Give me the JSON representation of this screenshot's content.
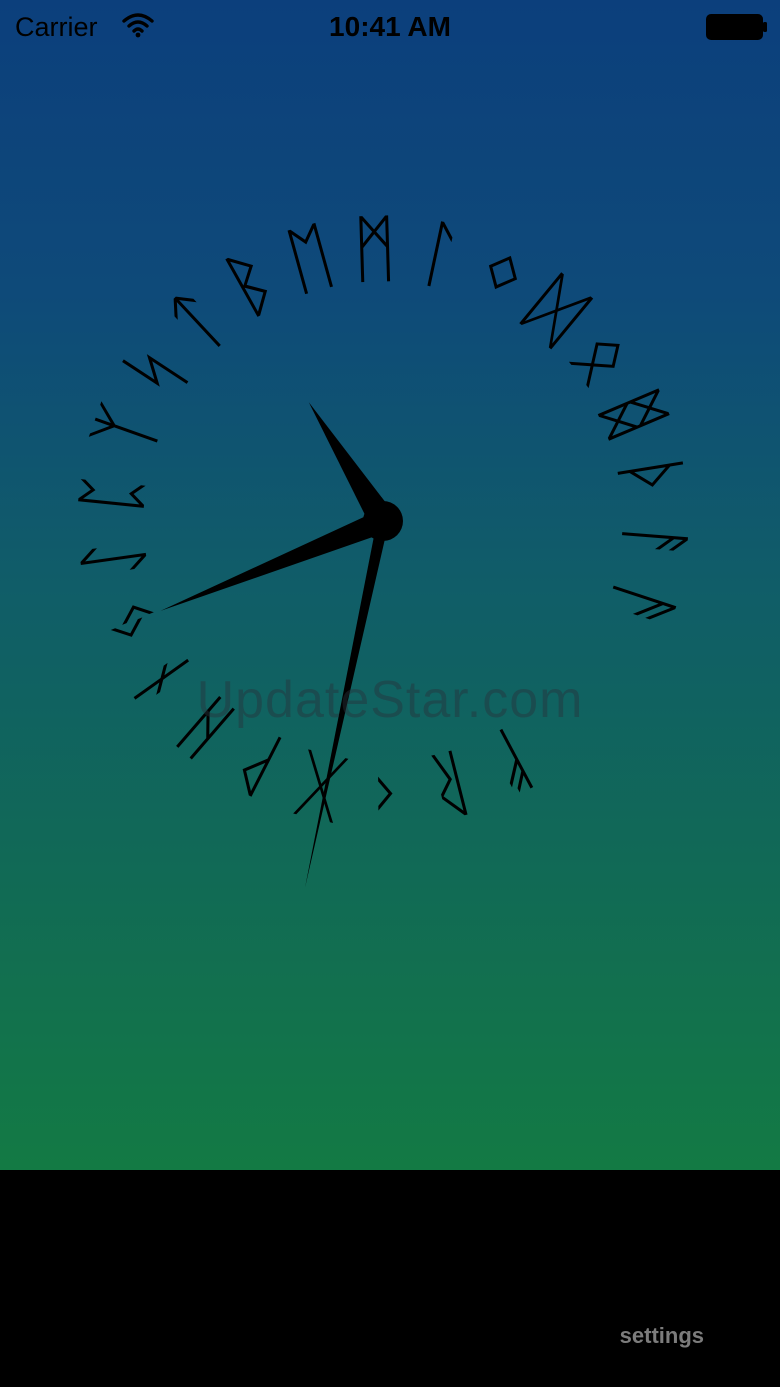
{
  "status_bar": {
    "carrier": "Carrier",
    "time": "10:41 AM",
    "wifi_icon": "wifi-icon",
    "battery_icon": "battery-full-icon"
  },
  "clock": {
    "face_style": "rune-ring",
    "runes": [
      "ᚠ",
      "ᚱ",
      "ᚲ",
      "ᚷ",
      "ᚹ",
      "ᚺ",
      "ᚾ",
      "ᛃ",
      "ᛇ",
      "ᛈ",
      "ᛉ",
      "ᛋ",
      "ᛏ",
      "ᛒ",
      "ᛖ",
      "ᛗ",
      "ᛚ",
      "ᛜ",
      "ᛞ",
      "ᛟ",
      "ᛥ",
      "ᚦ",
      "ᚨ",
      "ᚫ"
    ],
    "hour_hand_angle_deg": 328,
    "minute_hand_angle_deg": 248,
    "second_hand_angle_deg": 192,
    "hand_color": "#000000"
  },
  "watermark": "UpdateStar.com",
  "bottom_bar": {
    "settings_label": "settings"
  },
  "colors": {
    "gradient_top": "#0c3f7c",
    "gradient_bottom": "#137a44",
    "settings_text": "#7c7c7c"
  }
}
